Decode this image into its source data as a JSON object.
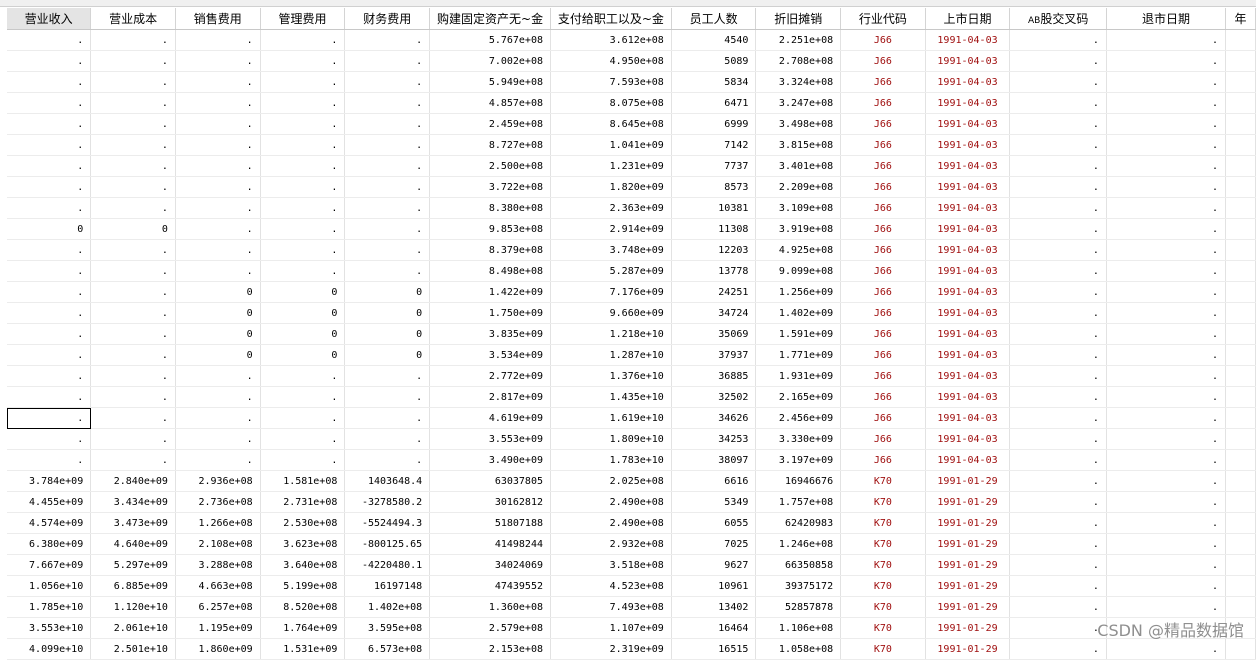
{
  "columns": [
    {
      "label": "营业收入"
    },
    {
      "label": "营业成本"
    },
    {
      "label": "销售费用"
    },
    {
      "label": "管理费用"
    },
    {
      "label": "财务费用"
    },
    {
      "label": "购建固定资产无~金"
    },
    {
      "label": "支付给职工以及~金"
    },
    {
      "label": "员工人数"
    },
    {
      "label": "折旧摊销"
    },
    {
      "label": "行业代码"
    },
    {
      "label": "上市日期"
    },
    {
      "label": "AB股交叉码",
      "prefix": "AB",
      "rest": "股交叉码"
    },
    {
      "label": "退市日期"
    },
    {
      "label": "年"
    }
  ],
  "rows": [
    [
      ".",
      ".",
      ".",
      ".",
      ".",
      "5.767e+08",
      "3.612e+08",
      "4540",
      "2.251e+08",
      "J66",
      "1991-04-03",
      ".",
      "."
    ],
    [
      ".",
      ".",
      ".",
      ".",
      ".",
      "7.002e+08",
      "4.950e+08",
      "5089",
      "2.708e+08",
      "J66",
      "1991-04-03",
      ".",
      "."
    ],
    [
      ".",
      ".",
      ".",
      ".",
      ".",
      "5.949e+08",
      "7.593e+08",
      "5834",
      "3.324e+08",
      "J66",
      "1991-04-03",
      ".",
      "."
    ],
    [
      ".",
      ".",
      ".",
      ".",
      ".",
      "4.857e+08",
      "8.075e+08",
      "6471",
      "3.247e+08",
      "J66",
      "1991-04-03",
      ".",
      "."
    ],
    [
      ".",
      ".",
      ".",
      ".",
      ".",
      "2.459e+08",
      "8.645e+08",
      "6999",
      "3.498e+08",
      "J66",
      "1991-04-03",
      ".",
      "."
    ],
    [
      ".",
      ".",
      ".",
      ".",
      ".",
      "8.727e+08",
      "1.041e+09",
      "7142",
      "3.815e+08",
      "J66",
      "1991-04-03",
      ".",
      "."
    ],
    [
      ".",
      ".",
      ".",
      ".",
      ".",
      "2.500e+08",
      "1.231e+09",
      "7737",
      "3.401e+08",
      "J66",
      "1991-04-03",
      ".",
      "."
    ],
    [
      ".",
      ".",
      ".",
      ".",
      ".",
      "3.722e+08",
      "1.820e+09",
      "8573",
      "2.209e+08",
      "J66",
      "1991-04-03",
      ".",
      "."
    ],
    [
      ".",
      ".",
      ".",
      ".",
      ".",
      "8.380e+08",
      "2.363e+09",
      "10381",
      "3.109e+08",
      "J66",
      "1991-04-03",
      ".",
      "."
    ],
    [
      "0",
      "0",
      ".",
      ".",
      ".",
      "9.853e+08",
      "2.914e+09",
      "11308",
      "3.919e+08",
      "J66",
      "1991-04-03",
      ".",
      "."
    ],
    [
      ".",
      ".",
      ".",
      ".",
      ".",
      "8.379e+08",
      "3.748e+09",
      "12203",
      "4.925e+08",
      "J66",
      "1991-04-03",
      ".",
      "."
    ],
    [
      ".",
      ".",
      ".",
      ".",
      ".",
      "8.498e+08",
      "5.287e+09",
      "13778",
      "9.099e+08",
      "J66",
      "1991-04-03",
      ".",
      "."
    ],
    [
      ".",
      ".",
      "0",
      "0",
      "0",
      "1.422e+09",
      "7.176e+09",
      "24251",
      "1.256e+09",
      "J66",
      "1991-04-03",
      ".",
      "."
    ],
    [
      ".",
      ".",
      "0",
      "0",
      "0",
      "1.750e+09",
      "9.660e+09",
      "34724",
      "1.402e+09",
      "J66",
      "1991-04-03",
      ".",
      "."
    ],
    [
      ".",
      ".",
      "0",
      "0",
      "0",
      "3.835e+09",
      "1.218e+10",
      "35069",
      "1.591e+09",
      "J66",
      "1991-04-03",
      ".",
      "."
    ],
    [
      ".",
      ".",
      "0",
      "0",
      "0",
      "3.534e+09",
      "1.287e+10",
      "37937",
      "1.771e+09",
      "J66",
      "1991-04-03",
      ".",
      "."
    ],
    [
      ".",
      ".",
      ".",
      ".",
      ".",
      "2.772e+09",
      "1.376e+10",
      "36885",
      "1.931e+09",
      "J66",
      "1991-04-03",
      ".",
      "."
    ],
    [
      ".",
      ".",
      ".",
      ".",
      ".",
      "2.817e+09",
      "1.435e+10",
      "32502",
      "2.165e+09",
      "J66",
      "1991-04-03",
      ".",
      "."
    ],
    [
      ".",
      ".",
      ".",
      ".",
      ".",
      "4.619e+09",
      "1.619e+10",
      "34626",
      "2.456e+09",
      "J66",
      "1991-04-03",
      ".",
      "."
    ],
    [
      ".",
      ".",
      ".",
      ".",
      ".",
      "3.553e+09",
      "1.809e+10",
      "34253",
      "3.330e+09",
      "J66",
      "1991-04-03",
      ".",
      "."
    ],
    [
      ".",
      ".",
      ".",
      ".",
      ".",
      "3.490e+09",
      "1.783e+10",
      "38097",
      "3.197e+09",
      "J66",
      "1991-04-03",
      ".",
      "."
    ],
    [
      "3.784e+09",
      "2.840e+09",
      "2.936e+08",
      "1.581e+08",
      "1403648.4",
      "63037805",
      "2.025e+08",
      "6616",
      "16946676",
      "K70",
      "1991-01-29",
      ".",
      "."
    ],
    [
      "4.455e+09",
      "3.434e+09",
      "2.736e+08",
      "2.731e+08",
      "-3278580.2",
      "30162812",
      "2.490e+08",
      "5349",
      "1.757e+08",
      "K70",
      "1991-01-29",
      ".",
      "."
    ],
    [
      "4.574e+09",
      "3.473e+09",
      "1.266e+08",
      "2.530e+08",
      "-5524494.3",
      "51807188",
      "2.490e+08",
      "6055",
      "62420983",
      "K70",
      "1991-01-29",
      ".",
      "."
    ],
    [
      "6.380e+09",
      "4.640e+09",
      "2.108e+08",
      "3.623e+08",
      "-800125.65",
      "41498244",
      "2.932e+08",
      "7025",
      "1.246e+08",
      "K70",
      "1991-01-29",
      ".",
      "."
    ],
    [
      "7.667e+09",
      "5.297e+09",
      "3.288e+08",
      "3.640e+08",
      "-4220480.1",
      "34024069",
      "3.518e+08",
      "9627",
      "66350858",
      "K70",
      "1991-01-29",
      ".",
      "."
    ],
    [
      "1.056e+10",
      "6.885e+09",
      "4.663e+08",
      "5.199e+08",
      "16197148",
      "47439552",
      "4.523e+08",
      "10961",
      "39375172",
      "K70",
      "1991-01-29",
      ".",
      "."
    ],
    [
      "1.785e+10",
      "1.120e+10",
      "6.257e+08",
      "8.520e+08",
      "1.402e+08",
      "1.360e+08",
      "7.493e+08",
      "13402",
      "52857878",
      "K70",
      "1991-01-29",
      ".",
      "."
    ],
    [
      "3.553e+10",
      "2.061e+10",
      "1.195e+09",
      "1.764e+09",
      "3.595e+08",
      "2.579e+08",
      "1.107e+09",
      "16464",
      "1.106e+08",
      "K70",
      "1991-01-29",
      ".",
      "."
    ],
    [
      "4.099e+10",
      "2.501e+10",
      "1.860e+09",
      "1.531e+09",
      "6.573e+08",
      "2.153e+08",
      "2.319e+09",
      "16515",
      "1.058e+08",
      "K70",
      "1991-01-29",
      ".",
      "."
    ]
  ],
  "watermark": "CSDN @精品数据馆"
}
